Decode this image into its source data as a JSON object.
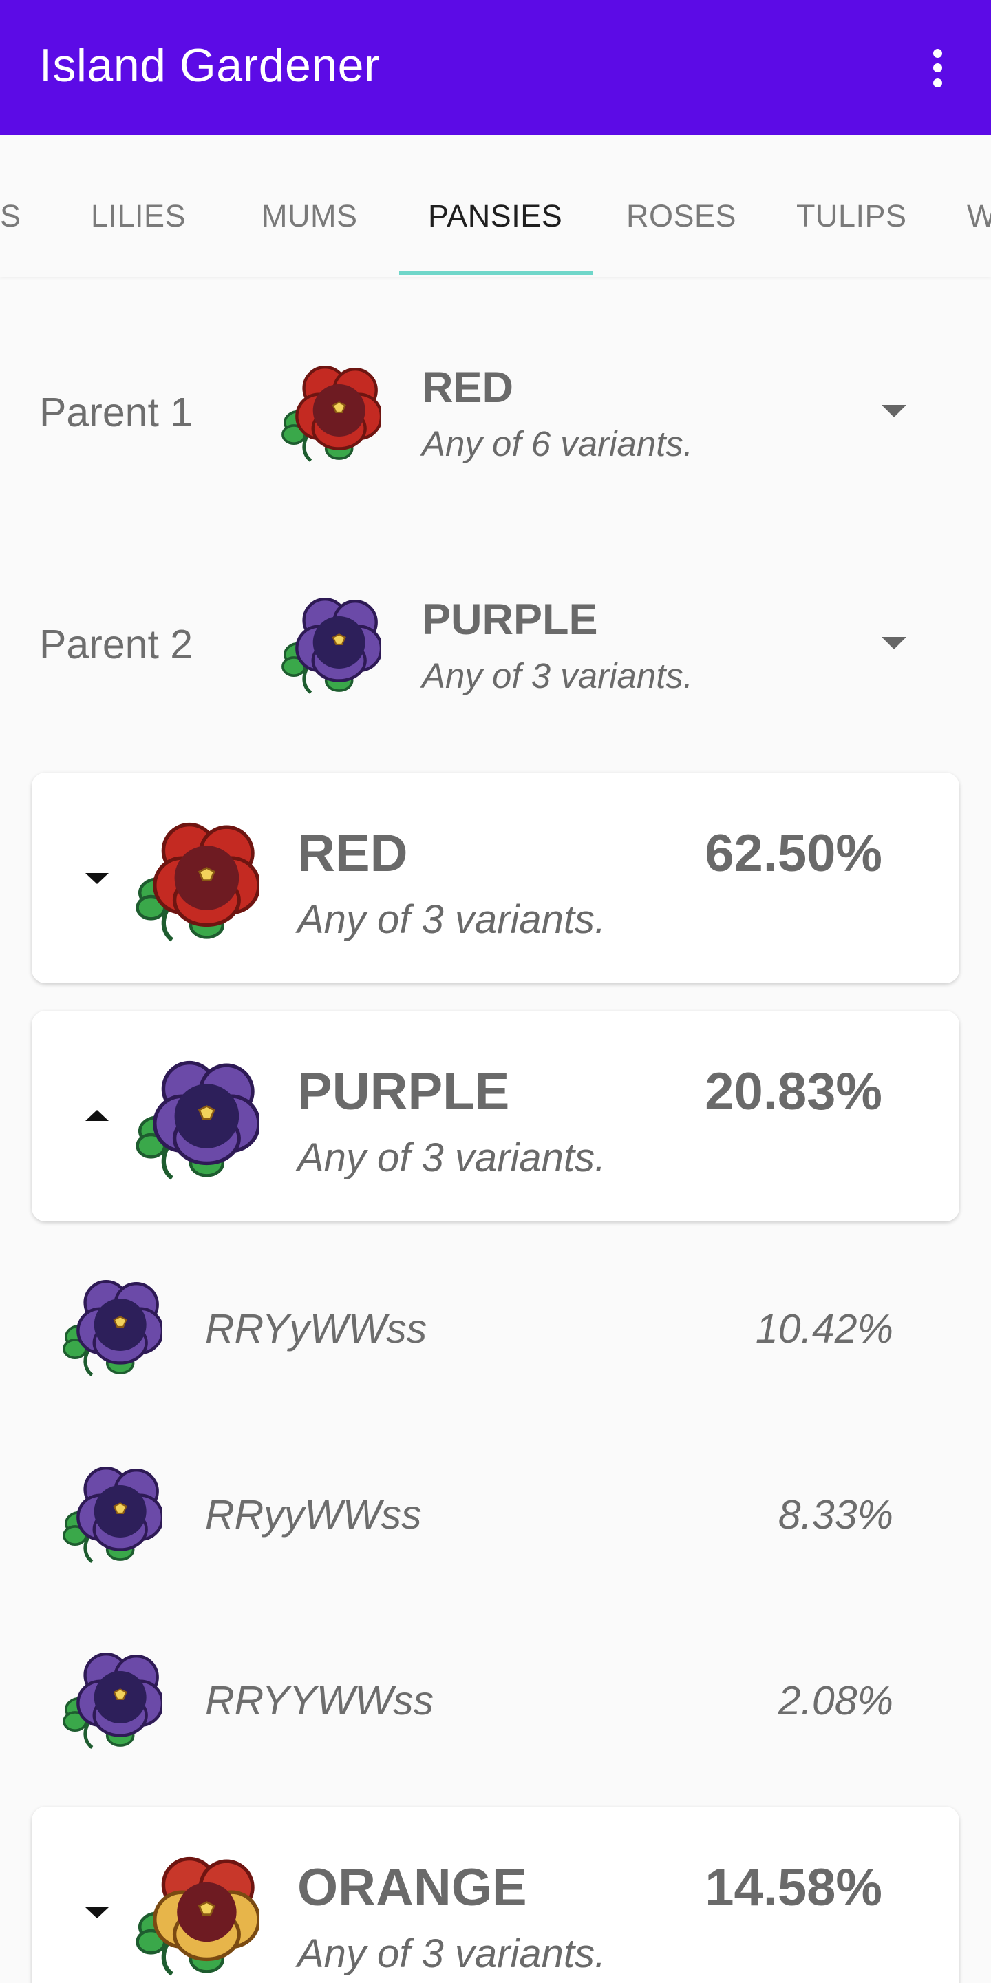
{
  "app": {
    "title": "Island Gardener",
    "menu_icon": "overflow-menu-icon"
  },
  "tabs": [
    {
      "label": "S"
    },
    {
      "label": "LILIES"
    },
    {
      "label": "MUMS"
    },
    {
      "label": "PANSIES",
      "active": true
    },
    {
      "label": "ROSES"
    },
    {
      "label": "TULIPS"
    },
    {
      "label": "W"
    }
  ],
  "colors": {
    "app_bar": "#5c0be6",
    "tab_indicator": "#6fd6c9",
    "red_petal": "#c42a22",
    "purple_petal": "#5b3a97",
    "orange_petal": "#d9a132"
  },
  "parents": [
    {
      "label": "Parent 1",
      "color": "RED",
      "variants": "Any of 6 variants.",
      "icon": "red-pansy-icon"
    },
    {
      "label": "Parent 2",
      "color": "PURPLE",
      "variants": "Any of 3 variants.",
      "icon": "purple-pansy-icon"
    }
  ],
  "results": [
    {
      "color": "RED",
      "variants": "Any of 3 variants.",
      "percent": "62.50%",
      "expanded": false,
      "icon": "red-pansy-icon"
    },
    {
      "color": "PURPLE",
      "variants": "Any of 3 variants.",
      "percent": "20.83%",
      "expanded": true,
      "icon": "purple-pansy-icon",
      "children": [
        {
          "genes": "RRYyWWss",
          "percent": "10.42%"
        },
        {
          "genes": "RRyyWWss",
          "percent": "8.33%"
        },
        {
          "genes": "RRYYWWss",
          "percent": "2.08%"
        }
      ]
    },
    {
      "color": "ORANGE",
      "variants": "Any of 3 variants.",
      "percent": "14.58%",
      "expanded": false,
      "icon": "orange-pansy-icon"
    }
  ]
}
